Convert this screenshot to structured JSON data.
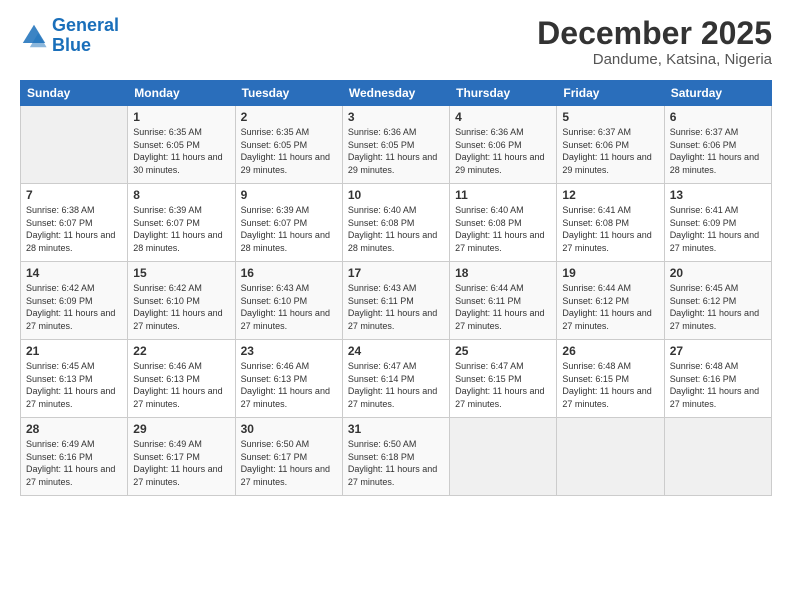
{
  "header": {
    "logo_line1": "General",
    "logo_line2": "Blue",
    "month": "December 2025",
    "location": "Dandume, Katsina, Nigeria"
  },
  "weekdays": [
    "Sunday",
    "Monday",
    "Tuesday",
    "Wednesday",
    "Thursday",
    "Friday",
    "Saturday"
  ],
  "weeks": [
    [
      {
        "day": "",
        "sunrise": "",
        "sunset": "",
        "daylight": ""
      },
      {
        "day": "1",
        "sunrise": "6:35 AM",
        "sunset": "6:05 PM",
        "daylight": "11 hours and 30 minutes."
      },
      {
        "day": "2",
        "sunrise": "6:35 AM",
        "sunset": "6:05 PM",
        "daylight": "11 hours and 29 minutes."
      },
      {
        "day": "3",
        "sunrise": "6:36 AM",
        "sunset": "6:05 PM",
        "daylight": "11 hours and 29 minutes."
      },
      {
        "day": "4",
        "sunrise": "6:36 AM",
        "sunset": "6:06 PM",
        "daylight": "11 hours and 29 minutes."
      },
      {
        "day": "5",
        "sunrise": "6:37 AM",
        "sunset": "6:06 PM",
        "daylight": "11 hours and 29 minutes."
      },
      {
        "day": "6",
        "sunrise": "6:37 AM",
        "sunset": "6:06 PM",
        "daylight": "11 hours and 28 minutes."
      }
    ],
    [
      {
        "day": "7",
        "sunrise": "6:38 AM",
        "sunset": "6:07 PM",
        "daylight": "11 hours and 28 minutes."
      },
      {
        "day": "8",
        "sunrise": "6:39 AM",
        "sunset": "6:07 PM",
        "daylight": "11 hours and 28 minutes."
      },
      {
        "day": "9",
        "sunrise": "6:39 AM",
        "sunset": "6:07 PM",
        "daylight": "11 hours and 28 minutes."
      },
      {
        "day": "10",
        "sunrise": "6:40 AM",
        "sunset": "6:08 PM",
        "daylight": "11 hours and 28 minutes."
      },
      {
        "day": "11",
        "sunrise": "6:40 AM",
        "sunset": "6:08 PM",
        "daylight": "11 hours and 27 minutes."
      },
      {
        "day": "12",
        "sunrise": "6:41 AM",
        "sunset": "6:08 PM",
        "daylight": "11 hours and 27 minutes."
      },
      {
        "day": "13",
        "sunrise": "6:41 AM",
        "sunset": "6:09 PM",
        "daylight": "11 hours and 27 minutes."
      }
    ],
    [
      {
        "day": "14",
        "sunrise": "6:42 AM",
        "sunset": "6:09 PM",
        "daylight": "11 hours and 27 minutes."
      },
      {
        "day": "15",
        "sunrise": "6:42 AM",
        "sunset": "6:10 PM",
        "daylight": "11 hours and 27 minutes."
      },
      {
        "day": "16",
        "sunrise": "6:43 AM",
        "sunset": "6:10 PM",
        "daylight": "11 hours and 27 minutes."
      },
      {
        "day": "17",
        "sunrise": "6:43 AM",
        "sunset": "6:11 PM",
        "daylight": "11 hours and 27 minutes."
      },
      {
        "day": "18",
        "sunrise": "6:44 AM",
        "sunset": "6:11 PM",
        "daylight": "11 hours and 27 minutes."
      },
      {
        "day": "19",
        "sunrise": "6:44 AM",
        "sunset": "6:12 PM",
        "daylight": "11 hours and 27 minutes."
      },
      {
        "day": "20",
        "sunrise": "6:45 AM",
        "sunset": "6:12 PM",
        "daylight": "11 hours and 27 minutes."
      }
    ],
    [
      {
        "day": "21",
        "sunrise": "6:45 AM",
        "sunset": "6:13 PM",
        "daylight": "11 hours and 27 minutes."
      },
      {
        "day": "22",
        "sunrise": "6:46 AM",
        "sunset": "6:13 PM",
        "daylight": "11 hours and 27 minutes."
      },
      {
        "day": "23",
        "sunrise": "6:46 AM",
        "sunset": "6:13 PM",
        "daylight": "11 hours and 27 minutes."
      },
      {
        "day": "24",
        "sunrise": "6:47 AM",
        "sunset": "6:14 PM",
        "daylight": "11 hours and 27 minutes."
      },
      {
        "day": "25",
        "sunrise": "6:47 AM",
        "sunset": "6:15 PM",
        "daylight": "11 hours and 27 minutes."
      },
      {
        "day": "26",
        "sunrise": "6:48 AM",
        "sunset": "6:15 PM",
        "daylight": "11 hours and 27 minutes."
      },
      {
        "day": "27",
        "sunrise": "6:48 AM",
        "sunset": "6:16 PM",
        "daylight": "11 hours and 27 minutes."
      }
    ],
    [
      {
        "day": "28",
        "sunrise": "6:49 AM",
        "sunset": "6:16 PM",
        "daylight": "11 hours and 27 minutes."
      },
      {
        "day": "29",
        "sunrise": "6:49 AM",
        "sunset": "6:17 PM",
        "daylight": "11 hours and 27 minutes."
      },
      {
        "day": "30",
        "sunrise": "6:50 AM",
        "sunset": "6:17 PM",
        "daylight": "11 hours and 27 minutes."
      },
      {
        "day": "31",
        "sunrise": "6:50 AM",
        "sunset": "6:18 PM",
        "daylight": "11 hours and 27 minutes."
      },
      {
        "day": "",
        "sunrise": "",
        "sunset": "",
        "daylight": ""
      },
      {
        "day": "",
        "sunrise": "",
        "sunset": "",
        "daylight": ""
      },
      {
        "day": "",
        "sunrise": "",
        "sunset": "",
        "daylight": ""
      }
    ]
  ]
}
